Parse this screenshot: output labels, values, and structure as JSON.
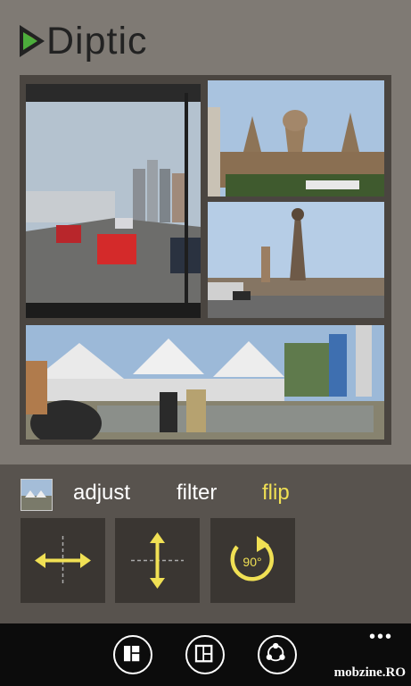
{
  "app": {
    "title": "Diptic"
  },
  "colors": {
    "background": "#7f7a74",
    "panel": "#58534e",
    "tool_button": "#3a3632",
    "accent": "#f0e054",
    "app_bar": "#0c0c0c"
  },
  "collage": {
    "photos": [
      {
        "name": "road-traffic-photo"
      },
      {
        "name": "palace-photo"
      },
      {
        "name": "plaza-tower-photo"
      },
      {
        "name": "fair-tents-photo"
      }
    ]
  },
  "edit_tabs": [
    {
      "label": "adjust",
      "active": false
    },
    {
      "label": "filter",
      "active": false
    },
    {
      "label": "flip",
      "active": true
    }
  ],
  "tools": [
    {
      "icon": "flip-horizontal-icon"
    },
    {
      "icon": "flip-vertical-icon"
    },
    {
      "icon": "rotate-90-icon",
      "label": "90°"
    }
  ],
  "app_bar": {
    "buttons": [
      {
        "icon": "layout-icon"
      },
      {
        "icon": "frame-icon"
      },
      {
        "icon": "share-icon"
      }
    ],
    "more": "•••"
  },
  "watermark": "mobzine.RO"
}
